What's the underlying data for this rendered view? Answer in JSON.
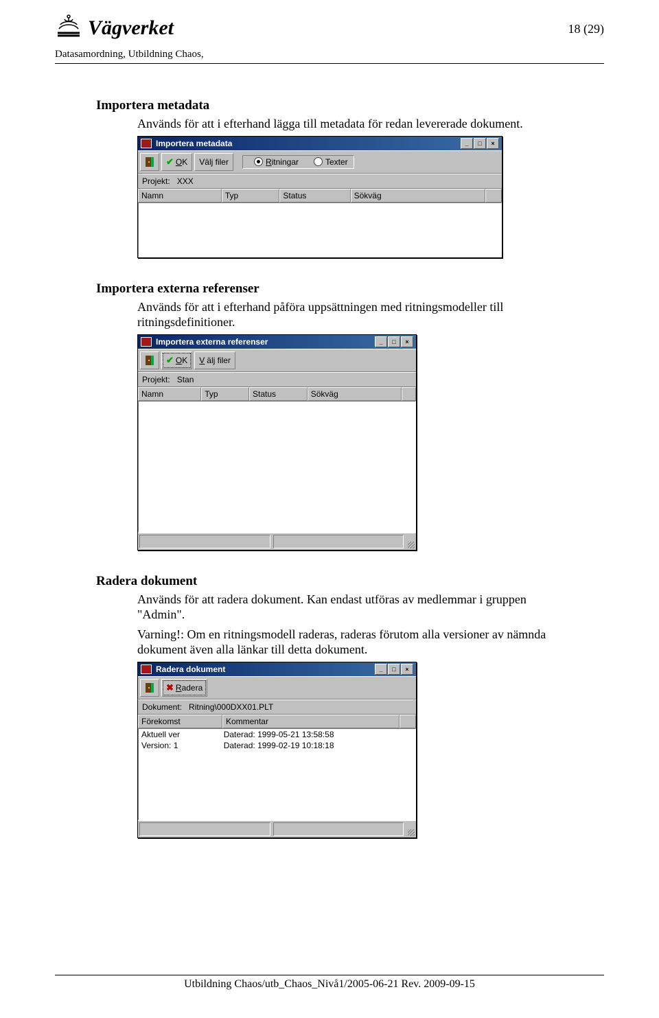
{
  "logo_text": "Vägverket",
  "page_number": "18 (29)",
  "subheader": "Datasamordning, Utbildning Chaos,",
  "footer": "Utbildning Chaos/utb_Chaos_Nivå1/2005-06-21 Rev. 2009-09-15",
  "sections": {
    "s1": {
      "title": "Importera metadata",
      "body": "Används för att i efterhand lägga till metadata för redan levererade dokument."
    },
    "s2": {
      "title": "Importera externa referenser",
      "body": "Används för att i efterhand påföra uppsättningen med ritningsmodeller till ritningsdefinitioner."
    },
    "s3": {
      "title": "Radera dokument",
      "body1": "Används för att radera dokument. Kan endast utföras av medlemmar i gruppen \"Admin\".",
      "body2": "Varning!: Om en ritningsmodell raderas, raderas förutom alla versioner av nämnda dokument även alla länkar till detta dokument."
    }
  },
  "win1": {
    "title": "Importera metadata",
    "ok": "OK",
    "valj": "Välj filer",
    "radios": {
      "ritningar": "Ritningar",
      "texter": "Texter"
    },
    "project_label": "Projekt:",
    "project_value": "XXX",
    "cols": {
      "namn": "Namn",
      "typ": "Typ",
      "status": "Status",
      "sokvag": "Sökväg"
    }
  },
  "win2": {
    "title": "Importera externa referenser",
    "ok": "OK",
    "valj": "Välj filer",
    "project_label": "Projekt:",
    "project_value": "Stan",
    "cols": {
      "namn": "Namn",
      "typ": "Typ",
      "status": "Status",
      "sokvag": "Sökväg"
    }
  },
  "win3": {
    "title": "Radera dokument",
    "radera": "Radera",
    "doc_label": "Dokument:",
    "doc_value": "Ritning\\000DXX01.PLT",
    "cols": {
      "forekomst": "Förekomst",
      "kommentar": "Kommentar"
    },
    "rows": [
      {
        "forekomst": "Aktuell ver",
        "kommentar": "Daterad: 1999-05-21 13:58:58"
      },
      {
        "forekomst": "Version: 1",
        "kommentar": "Daterad: 1999-02-19 10:18:18"
      }
    ]
  }
}
